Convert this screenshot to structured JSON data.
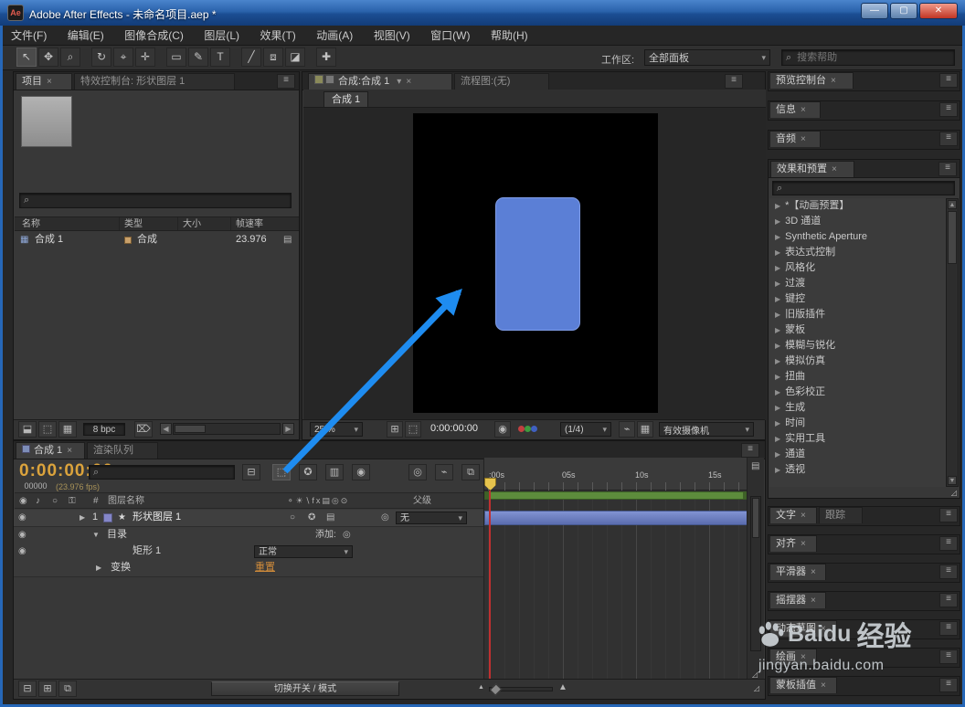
{
  "window": {
    "title": "Adobe After Effects - 未命名项目.aep *",
    "icon": "Ae"
  },
  "menu_bar": {
    "items": [
      "文件(F)",
      "编辑(E)",
      "图像合成(C)",
      "图层(L)",
      "效果(T)",
      "动画(A)",
      "视图(V)",
      "窗口(W)",
      "帮助(H)"
    ]
  },
  "toolbar": {
    "tools": [
      {
        "name": "selection",
        "glyph": "↖"
      },
      {
        "name": "hand",
        "glyph": "✥"
      },
      {
        "name": "zoom",
        "glyph": "⌕"
      },
      {
        "name": "rotation",
        "glyph": "↻"
      },
      {
        "name": "unified-camera",
        "glyph": "⌖"
      },
      {
        "name": "pan-behind",
        "glyph": "✛"
      },
      {
        "name": "shape",
        "glyph": "▭"
      },
      {
        "name": "pen",
        "glyph": "✎"
      },
      {
        "name": "type",
        "glyph": "T"
      },
      {
        "name": "brush",
        "glyph": "╱"
      },
      {
        "name": "clone-stamp",
        "glyph": "⧈"
      },
      {
        "name": "eraser",
        "glyph": "◪"
      },
      {
        "name": "puppet",
        "glyph": "✚"
      }
    ],
    "workspace_label": "工作区:",
    "workspace_value": "全部面板",
    "help_search_placeholder": "搜索帮助"
  },
  "project_panel": {
    "tab_project": "项目",
    "tab_effect_controls": "特效控制台: 形状图层 1",
    "columns": {
      "name": "名称",
      "type": "类型",
      "size": "大小",
      "fps": "帧速率"
    },
    "row": {
      "name": "合成 1",
      "type": "合成",
      "fps": "23.976"
    },
    "bpc": "8 bpc"
  },
  "comp_panel": {
    "tab_comp": "合成:合成 1",
    "tab_flowchart": "流程图:(无)",
    "sub_tab": "合成 1",
    "zoom": "25 %",
    "timecode": "0:00:00:00",
    "resolution": "(1/4)",
    "camera": "有效摄像机"
  },
  "timeline": {
    "tab_comp": "合成 1",
    "tab_render_queue": "渲染队列",
    "timecode": "0:00:00:00",
    "frames": "00000",
    "fps": "(23.976 fps)",
    "hash": "#",
    "layer_name_col": "图层名称",
    "switches_header": "⚬☀∖fx▤◎⊙",
    "parent_col": "父级",
    "layer": {
      "index": "1",
      "name": "形状图层 1",
      "parent": "无"
    },
    "contents": "目录",
    "add_label": "添加:",
    "rect": "矩形 1",
    "mode": "正常",
    "transform": "变换",
    "reset": "重置",
    "ruler": [
      ":00s",
      "05s",
      "10s",
      "15s"
    ],
    "mode_button": "切换开关 / 模式"
  },
  "right_panels": {
    "top": [
      {
        "title": "预览控制台"
      },
      {
        "title": "信息"
      },
      {
        "title": "音频"
      }
    ],
    "effects": {
      "title": "效果和预置",
      "items": [
        "*【动画预置】",
        "3D 通道",
        "Synthetic Aperture",
        "表达式控制",
        "风格化",
        "过渡",
        "键控",
        "旧版插件",
        "蒙板",
        "模糊与锐化",
        "模拟仿真",
        "扭曲",
        "色彩校正",
        "生成",
        "时间",
        "实用工具",
        "通道",
        "透视"
      ]
    },
    "bottom": [
      {
        "tabs": [
          {
            "label": "文字"
          },
          {
            "label": "跟踪"
          }
        ]
      },
      {
        "tabs": [
          {
            "label": "对齐"
          }
        ]
      },
      {
        "tabs": [
          {
            "label": "平滑器"
          }
        ]
      },
      {
        "tabs": [
          {
            "label": "摇摆器"
          }
        ]
      },
      {
        "tabs": [
          {
            "label": "动态草图"
          }
        ]
      },
      {
        "tabs": [
          {
            "label": "绘画"
          }
        ]
      },
      {
        "tabs": [
          {
            "label": "蒙板插值"
          }
        ]
      }
    ]
  },
  "watermark": {
    "brand": "Baidu",
    "suffix": "经验",
    "url": "jingyan.baidu.com"
  },
  "colors": {
    "accent_blue": "#5b7fd6",
    "arrow_blue": "#1e8cf0",
    "time_orange": "#dba33c",
    "reset_orange": "#d08b3a",
    "workarea_green": "#5d8c3c"
  },
  "icons": {
    "close": "×",
    "menu": "≡",
    "dropdown": "▾",
    "search": "⌕",
    "tree_right": "▶",
    "tree_down": "▼",
    "eye": "◉",
    "audio": "♪",
    "solo": "○",
    "lock": "⚿",
    "star": "★",
    "pickwhip": "◎",
    "flowchart": "⊟",
    "draft3d": "◬",
    "shy": "✪",
    "frame_blend": "▥",
    "motion_blur": "◉",
    "live_update": "⌁",
    "graph_editor": "⧉",
    "film": "▤",
    "interpret_footage": "⬓",
    "new_folder": "⬚",
    "new_comp": "▦",
    "trash": "⌦",
    "left_arrow": "◀",
    "right_arrow": "▶",
    "up_arrow": "▲",
    "down_arrow": "▼",
    "grid": "⊞",
    "roi": "⬚",
    "snapshot": "◉",
    "transparency": "▦",
    "grip": "◿",
    "swatch": "■",
    "ibeam": "I"
  }
}
